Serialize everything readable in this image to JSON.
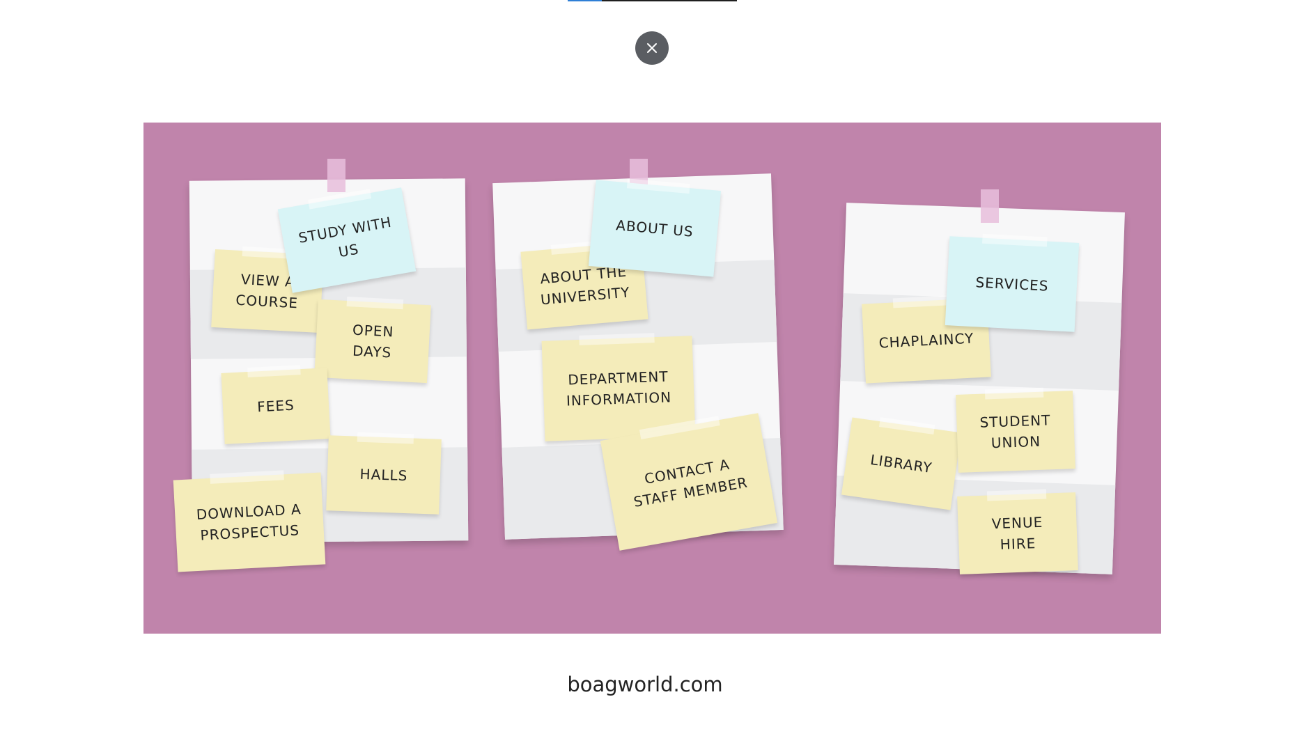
{
  "progress": {
    "fraction": 0.2
  },
  "close_button": {
    "icon": "close-icon",
    "label": "×"
  },
  "illustration": {
    "background_color": "#c084ab",
    "boards": [
      {
        "name": "board-left",
        "notes": [
          {
            "id": "study-with-us",
            "text": "Study with\nus",
            "color": "blue"
          },
          {
            "id": "view-a-course",
            "text": "View a\ncourse",
            "color": "yellow"
          },
          {
            "id": "open-days",
            "text": "Open\ndays",
            "color": "yellow"
          },
          {
            "id": "fees",
            "text": "Fees",
            "color": "yellow"
          },
          {
            "id": "halls",
            "text": "Halls",
            "color": "yellow"
          },
          {
            "id": "download-a-prospectus",
            "text": "Download a\nprospectus",
            "color": "yellow"
          }
        ]
      },
      {
        "name": "board-middle",
        "notes": [
          {
            "id": "about-us",
            "text": "About us",
            "color": "blue"
          },
          {
            "id": "about-the-university",
            "text": "About the\nuniversity",
            "color": "yellow"
          },
          {
            "id": "department-information",
            "text": "Department\ninformation",
            "color": "yellow"
          },
          {
            "id": "contact-a-staff-member",
            "text": "Contact a\nstaff member",
            "color": "yellow"
          }
        ]
      },
      {
        "name": "board-right",
        "notes": [
          {
            "id": "services",
            "text": "Services",
            "color": "blue"
          },
          {
            "id": "chaplaincy",
            "text": "Chaplaincy",
            "color": "yellow"
          },
          {
            "id": "library",
            "text": "Library",
            "color": "yellow"
          },
          {
            "id": "student-union",
            "text": "Student\nunion",
            "color": "yellow"
          },
          {
            "id": "venue-hire",
            "text": "Venue\nhire",
            "color": "yellow"
          }
        ]
      }
    ]
  },
  "caption": "boagworld.com"
}
